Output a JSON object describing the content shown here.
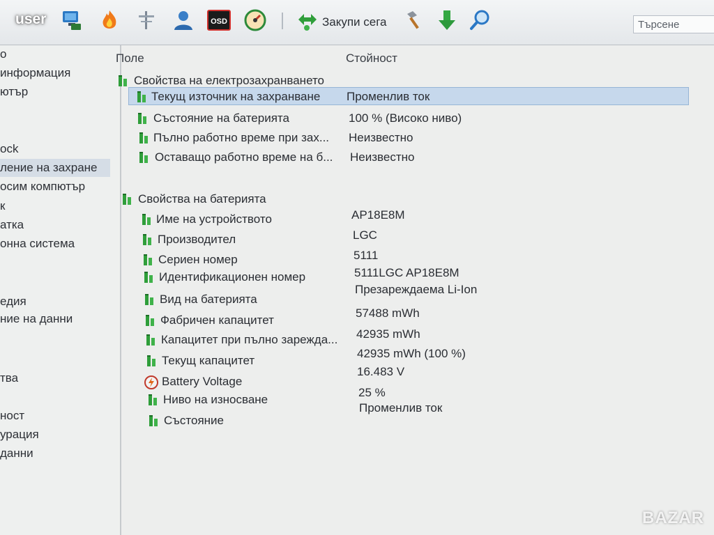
{
  "toolbar": {
    "user": "user",
    "buy_label": "Закупи сега",
    "search_placeholder": "Търсене",
    "icons": [
      "computer-icon",
      "flame-icon",
      "network-icon",
      "user-icon",
      "osd-icon",
      "gauge-icon",
      "buy-now-icon",
      "tools-icon",
      "download-icon",
      "search-icon"
    ],
    "osd_text": "OSD"
  },
  "nav": {
    "items": [
      "о",
      "информация",
      "ютър",
      "",
      "",
      "ock",
      "ление на захране",
      "осим компютър",
      "к",
      "атка",
      "онна система",
      "",
      "",
      "едия",
      "ние на данни",
      "",
      "",
      "тва",
      "",
      "ност",
      "урация",
      "данни"
    ],
    "selected_index": 6
  },
  "columns": {
    "field": "Поле",
    "value": "Стойност"
  },
  "power_group": {
    "title": "Свойства на електрозахранването",
    "rows": [
      {
        "label": "Текущ източник на захранване",
        "value": "Променлив ток"
      },
      {
        "label": "Състояние на батерията",
        "value": "100 % (Високо ниво)"
      },
      {
        "label": "Пълно работно време при зах...",
        "value": "Неизвестно"
      },
      {
        "label": "Оставащо работно време на б...",
        "value": "Неизвестно"
      }
    ]
  },
  "battery_group": {
    "title": "Свойства на батерията",
    "rows": [
      {
        "label": "Име на устройството",
        "value": "AP18E8M",
        "icon": "battery-icon"
      },
      {
        "label": "Производител",
        "value": "LGC",
        "icon": "battery-icon"
      },
      {
        "label": "Сериен номер",
        "value": "5111",
        "icon": "battery-icon"
      },
      {
        "label": "Идентификационен номер",
        "value": "5111LGC AP18E8M",
        "icon": "battery-icon"
      },
      {
        "label": "Вид на батерията",
        "value": "Презареждаема Li-Ion",
        "icon": "battery-icon"
      },
      {
        "label": "Фабричен капацитет",
        "value": "57488 mWh",
        "icon": "battery-icon"
      },
      {
        "label": "Капацитет при пълно зарежда...",
        "value": "42935 mWh",
        "icon": "battery-icon"
      },
      {
        "label": "Текущ капацитет",
        "value": "42935 mWh  (100 %)",
        "icon": "battery-icon"
      },
      {
        "label": "Battery Voltage",
        "value": "16.483 V",
        "icon": "voltage-icon"
      },
      {
        "label": "Ниво на износване",
        "value": "25 %",
        "icon": "battery-icon"
      },
      {
        "label": "Състояние",
        "value": "Променлив ток",
        "icon": "battery-icon"
      }
    ]
  },
  "watermark": "BAZAR",
  "colors": {
    "accent": "#2f9e3a",
    "selection": "#c6d8ec"
  }
}
